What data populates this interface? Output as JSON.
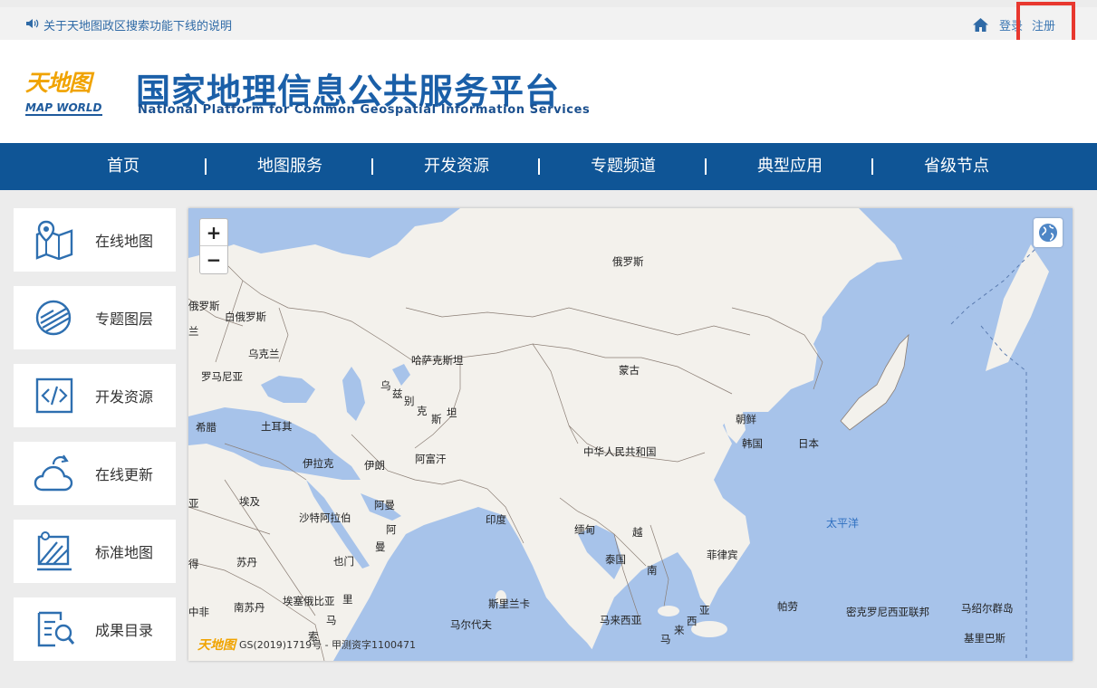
{
  "topbar": {
    "notice": "关于天地图政区搜索功能下线的说明",
    "login": "登录",
    "register": "注册"
  },
  "header": {
    "logo_cn": "天地图",
    "logo_en": "MAP WORLD",
    "title_cn": "国家地理信息公共服务平台",
    "title_en": "National Platform for Common Geospatial Information Services"
  },
  "nav": [
    "首页",
    "地图服务",
    "开发资源",
    "专题频道",
    "典型应用",
    "省级节点"
  ],
  "sidebar": [
    {
      "label": "在线地图",
      "icon": "map-pin-icon"
    },
    {
      "label": "专题图层",
      "icon": "layers-icon"
    },
    {
      "label": "开发资源",
      "icon": "code-icon"
    },
    {
      "label": "在线更新",
      "icon": "cloud-icon"
    },
    {
      "label": "标准地图",
      "icon": "standard-map-icon"
    },
    {
      "label": "成果目录",
      "icon": "catalog-icon"
    }
  ],
  "map": {
    "zoom_in": "+",
    "zoom_out": "−",
    "copyright": "GS(2019)1719号 - 甲测资字1100471",
    "copyright_logo": "天地图",
    "labels": {
      "russia": "俄罗斯",
      "russia_w": "俄罗斯",
      "belarus": "白俄罗斯",
      "ukraine": "乌克兰",
      "poland": "兰",
      "romania": "罗马尼亚",
      "kazakhstan": "哈萨克斯坦",
      "uzbek_1": "乌",
      "uzbek_2": "兹",
      "uzbek_3": "别",
      "uzbek_4": "克",
      "uzbek_5": "斯",
      "uzbek_6": "坦",
      "mongolia": "蒙古",
      "nkorea": "朝鲜",
      "skorea": "韩国",
      "japan": "日本",
      "china": "中华人民共和国",
      "greece": "希腊",
      "turkey": "土耳其",
      "iraq": "伊拉克",
      "iran": "伊朗",
      "afghanistan": "阿富汗",
      "egypt": "埃及",
      "saudi": "沙特阿拉伯",
      "oman": "阿曼",
      "oman2": "阿",
      "oman3": "曼",
      "india": "印度",
      "myanmar": "缅甸",
      "vietnam": "越",
      "vietnam2": "南",
      "thailand": "泰国",
      "philippines": "菲律宾",
      "pacific": "太平洋",
      "sudan": "苏丹",
      "yemen": "也门",
      "chad": "得",
      "asia_left": "亚",
      "south_sudan": "南苏丹",
      "ethiopia": "埃塞俄比亚",
      "somalia": "里",
      "somalia2": "马",
      "somalia3": "索",
      "central_africa": "中非",
      "srilanka": "斯里兰卡",
      "maldives": "马尔代夫",
      "malaysia": "马来西亚",
      "malaysia2": "亚",
      "malaysia3": "来",
      "malaysia4": "西",
      "malaysia5": "马",
      "palau": "帕劳",
      "micronesia": "密克罗尼西亚联邦",
      "marshall": "马绍尔群岛",
      "kiribati": "基里巴斯",
      "car": "中非共和国",
      "mpa": "马"
    }
  }
}
